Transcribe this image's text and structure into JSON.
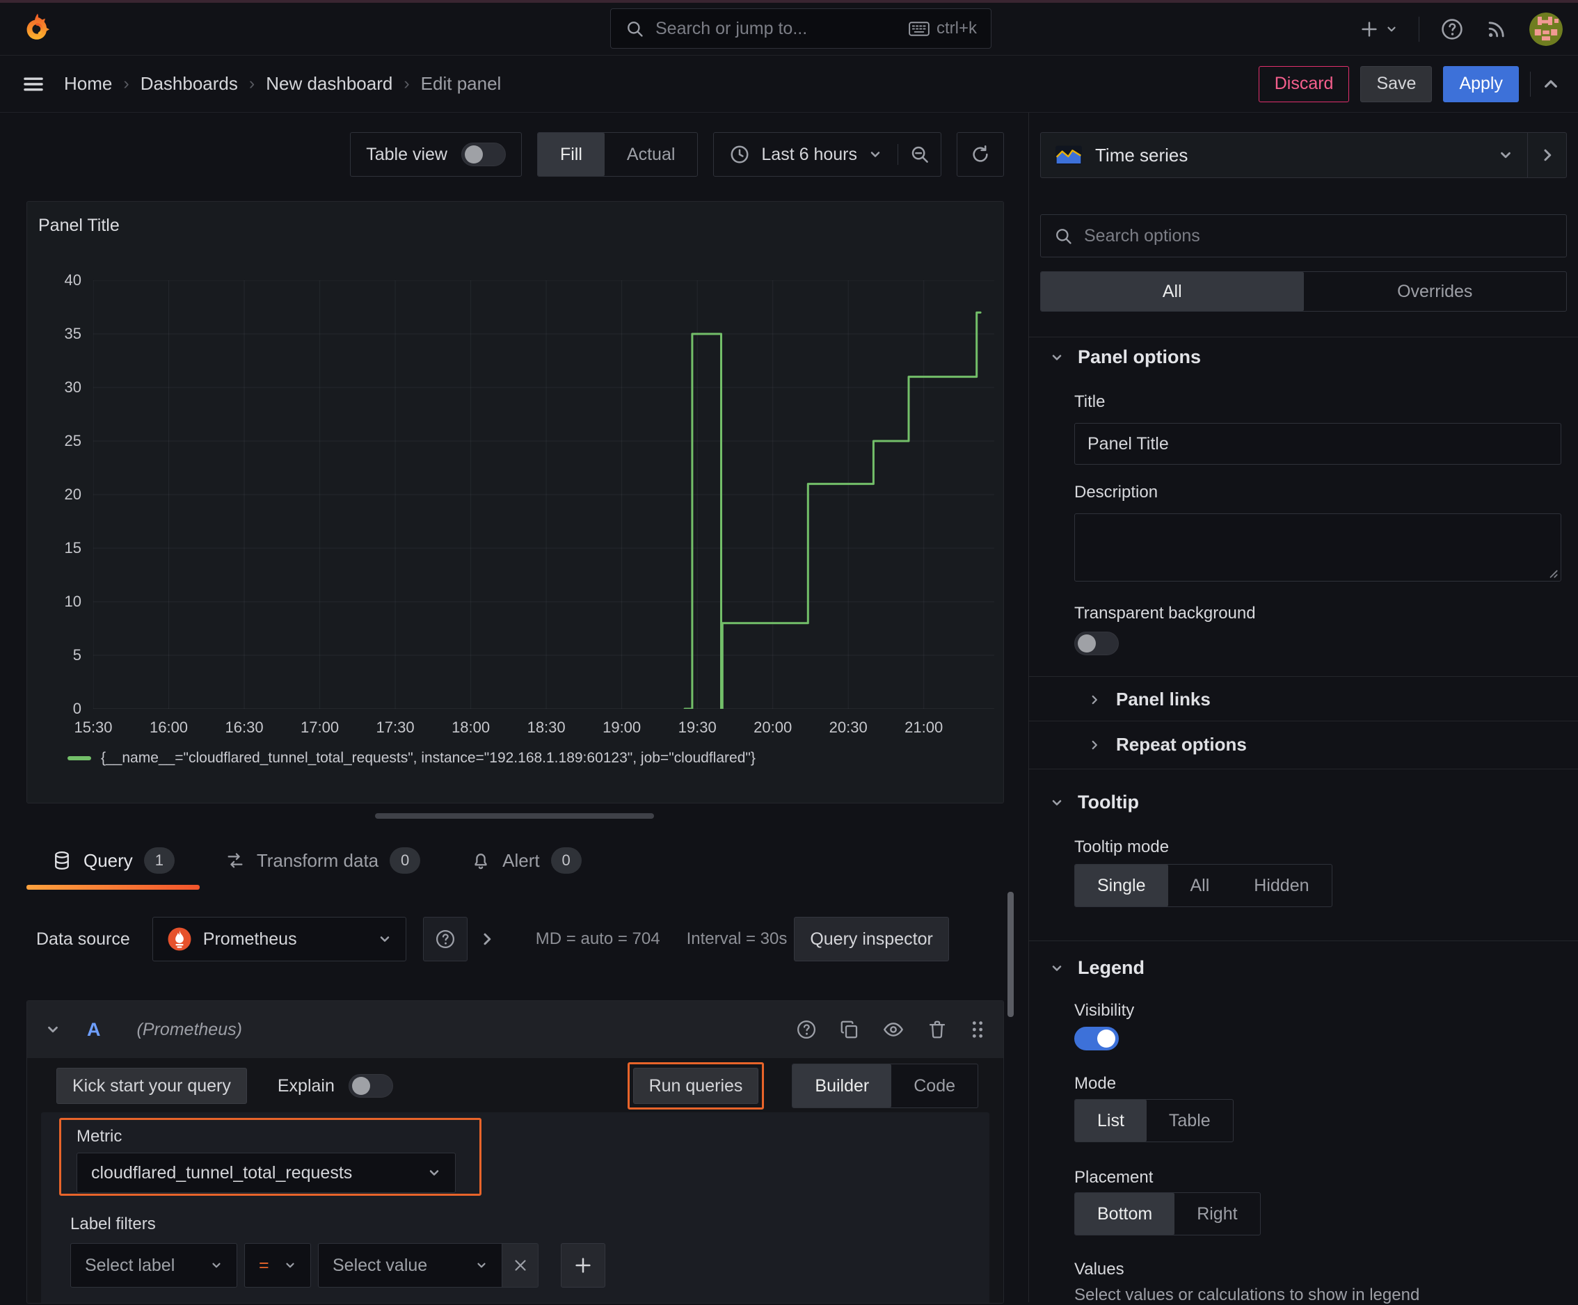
{
  "colors": {
    "green": "#73bf69",
    "blue": "#3d71d9",
    "orange": "#e8642a",
    "pink": "#f55f8d",
    "pink_border": "#e02f6c",
    "orange_tab_a": "#ffa23e",
    "orange_tab_b": "#f2542c",
    "letter_blue": "#6e9fff",
    "prometheus_orange": "#e6522c"
  },
  "topnav": {
    "search_placeholder": "Search or jump to...",
    "shortcut": "ctrl+k"
  },
  "breadcrumb": {
    "sep": "›",
    "items": [
      "Home",
      "Dashboards",
      "New dashboard",
      "Edit panel"
    ]
  },
  "actions": {
    "discard": "Discard",
    "save": "Save",
    "apply": "Apply"
  },
  "toolbar": {
    "table_view": "Table view",
    "fill": "Fill",
    "actual": "Actual",
    "time_range": "Last 6 hours"
  },
  "viz_picker": {
    "label": "Time series"
  },
  "panel": {
    "title": "Panel Title"
  },
  "chart_data": {
    "type": "line",
    "line_interpolation": "step-after",
    "title": "Panel Title",
    "grid": true,
    "legend_position": "bottom-left",
    "x_axis": {
      "start": "15:30",
      "tick_labels": [
        "15:30",
        "16:00",
        "16:30",
        "17:00",
        "17:30",
        "18:00",
        "18:30",
        "19:00",
        "19:30",
        "20:00",
        "20:30",
        "21:00"
      ],
      "tick_minutes": [
        0,
        30,
        60,
        90,
        120,
        150,
        180,
        210,
        240,
        270,
        300,
        330
      ],
      "range_minutes": [
        0,
        358
      ]
    },
    "y_axis": {
      "ticks": [
        0,
        5,
        10,
        15,
        20,
        25,
        30,
        35,
        40
      ],
      "range": [
        0,
        40
      ]
    },
    "series": [
      {
        "name": "{__name__=\"cloudflared_tunnel_total_requests\", instance=\"192.168.1.189:60123\", job=\"cloudflared\"}",
        "color": "#73bf69",
        "points": [
          {
            "time": "19:25",
            "minutes": 235,
            "value": 0
          },
          {
            "time": "19:28",
            "minutes": 238,
            "value": 35
          },
          {
            "time": "19:39",
            "minutes": 249.5,
            "value": 0
          },
          {
            "time": "19:40",
            "minutes": 250,
            "value": 8
          },
          {
            "time": "20:14",
            "minutes": 284,
            "value": 21
          },
          {
            "time": "20:40",
            "minutes": 310,
            "value": 25
          },
          {
            "time": "20:54",
            "minutes": 324,
            "value": 31
          },
          {
            "time": "21:21",
            "minutes": 351,
            "value": 37
          },
          {
            "time": "21:22",
            "minutes": 352.5,
            "value": 37
          }
        ]
      }
    ]
  },
  "query_tabs": [
    {
      "label": "Query",
      "badge": "1"
    },
    {
      "label": "Transform data",
      "badge": "0"
    },
    {
      "label": "Alert",
      "badge": "0"
    }
  ],
  "query": {
    "datasource_label": "Data source",
    "datasource_name": "Prometheus",
    "stats_md": "MD = auto = 704",
    "stats_interval": "Interval = 30s",
    "inspector": "Query inspector",
    "row_letter": "A",
    "row_ds": "(Prometheus)",
    "kick_start": "Kick start your query",
    "explain": "Explain",
    "run_queries": "Run queries",
    "builder": "Builder",
    "code": "Code",
    "metric_label": "Metric",
    "metric_value": "cloudflared_tunnel_total_requests",
    "label_filters": "Label filters",
    "select_label": "Select label",
    "operator": "=",
    "select_value": "Select value"
  },
  "options": {
    "search_placeholder": "Search options",
    "tab_all": "All",
    "tab_overrides": "Overrides",
    "panel_options": {
      "header": "Panel options",
      "title_label": "Title",
      "title_value": "Panel Title",
      "description_label": "Description",
      "transparent_label": "Transparent background"
    },
    "panel_links": "Panel links",
    "repeat_options": "Repeat options",
    "tooltip": {
      "header": "Tooltip",
      "mode_label": "Tooltip mode",
      "modes": [
        "Single",
        "All",
        "Hidden"
      ],
      "selected": "Single"
    },
    "legend": {
      "header": "Legend",
      "visibility_label": "Visibility",
      "visibility_on": true,
      "mode_label": "Mode",
      "modes": [
        "List",
        "Table"
      ],
      "mode_selected": "List",
      "placement_label": "Placement",
      "placements": [
        "Bottom",
        "Right"
      ],
      "placement_selected": "Bottom",
      "values_label": "Values",
      "values_hint": "Select values or calculations to show in legend"
    }
  }
}
